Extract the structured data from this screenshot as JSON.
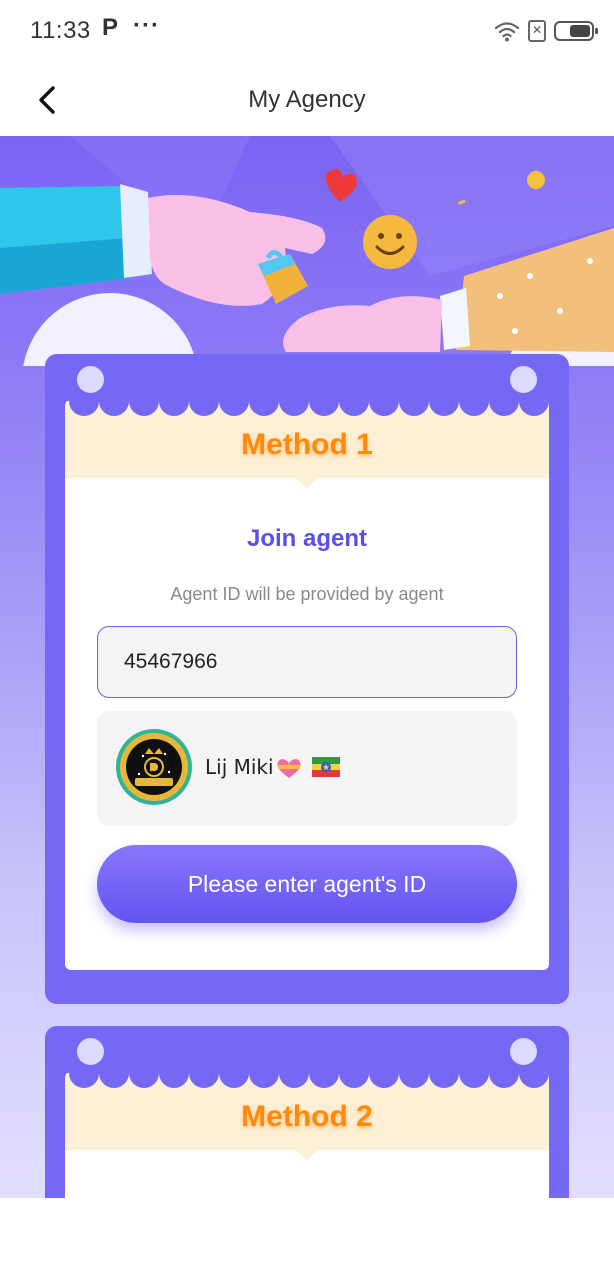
{
  "status_bar": {
    "time": "11:33",
    "app_indicator": "P",
    "more": "···",
    "icons": [
      "wifi-icon",
      "no-sim-icon",
      "battery-icon"
    ]
  },
  "header": {
    "back_icon": "chevron-left-icon",
    "title": "My Agency"
  },
  "method1": {
    "title": "Method 1",
    "join_title": "Join agent",
    "hint": "Agent ID will be provided by agent",
    "agent_id_value": "45467966",
    "agent": {
      "name": "Lij Miki",
      "emoji": [
        "heart-with-ribbon-icon",
        "ethiopia-flag-icon"
      ]
    },
    "submit_label": "Please enter agent's ID"
  },
  "method2": {
    "title": "Method 2"
  },
  "colors": {
    "accent": "#6354f0",
    "card": "#7568f5",
    "method_title": "#ff8a0c",
    "method_header_bg": "#fdf0d6"
  }
}
